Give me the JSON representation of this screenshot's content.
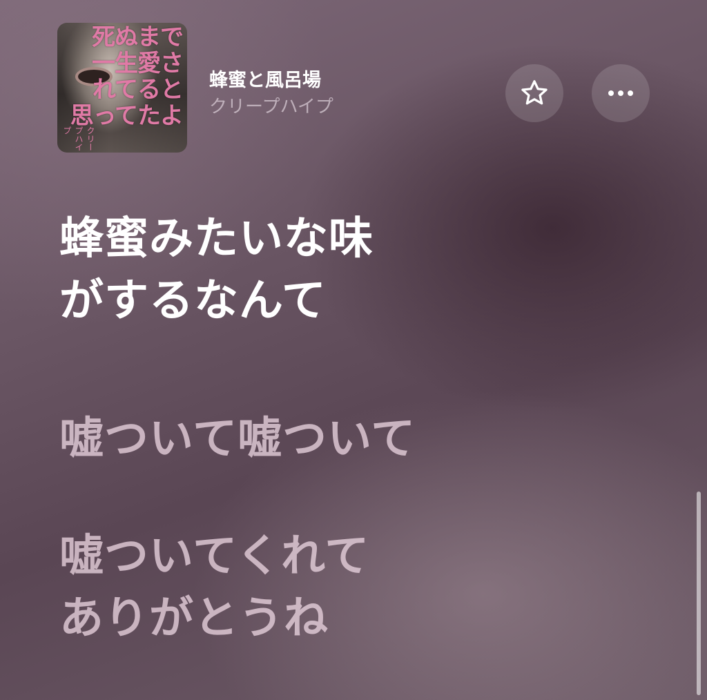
{
  "now_playing": {
    "title": "蜂蜜と風呂場",
    "artist": "クリープハイプ",
    "artwork": {
      "cover_text": "死ぬまで\n一生愛さ\nれてると\n思ってたよ",
      "side_text": "クリープハイプ",
      "accent_color": "#e07aa6"
    }
  },
  "actions": {
    "favorite_icon": "star-outline-icon",
    "more_icon": "ellipsis-icon"
  },
  "lyrics": {
    "lines": [
      {
        "text": "蜂蜜みたいな味",
        "active": true
      },
      {
        "text": "がするなんて",
        "active": true
      },
      {
        "text": "嘘ついて嘘ついて",
        "active": false
      },
      {
        "text": "嘘ついてくれて",
        "active": false
      },
      {
        "text": "ありがとうね",
        "active": false
      }
    ]
  },
  "colors": {
    "active_lyric": "#ffffff",
    "inactive_lyric": "#e8d2de",
    "background_dark": "#5a4654",
    "background_light": "#7d6878"
  }
}
